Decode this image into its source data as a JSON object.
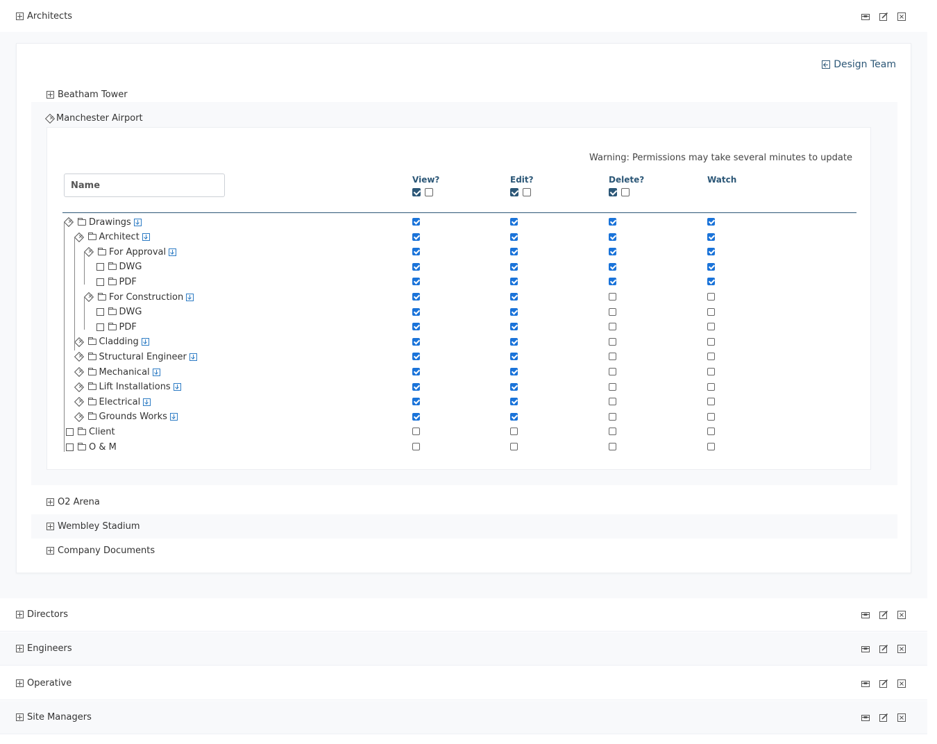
{
  "groups": [
    {
      "label": "Architects",
      "expanded": true
    },
    {
      "label": "Directors"
    },
    {
      "label": "Engineers"
    },
    {
      "label": "Operative"
    },
    {
      "label": "Site Managers"
    }
  ],
  "design_team_link": "Design Team",
  "projects": {
    "beatham": "Beatham Tower",
    "manchester": "Manchester Airport",
    "o2": "O2 Arena",
    "wembley": "Wembley Stadium",
    "company_docs": "Company Documents"
  },
  "permissions": {
    "warning": "Warning: Permissions may take several minutes to update",
    "name_placeholder": "Name",
    "columns": {
      "view": "View?",
      "edit": "Edit?",
      "delete": "Delete?",
      "watch": "Watch"
    },
    "header_checks": {
      "view": [
        true,
        false
      ],
      "edit": [
        true,
        false
      ],
      "delete": [
        true,
        false
      ]
    },
    "rows": [
      {
        "label": "Drawings",
        "level": 0,
        "type": "expanded",
        "download": true,
        "view": true,
        "edit": true,
        "delete": true,
        "watch": true
      },
      {
        "label": "Architect",
        "level": 1,
        "type": "expanded",
        "download": true,
        "view": true,
        "edit": true,
        "delete": true,
        "watch": true
      },
      {
        "label": "For Approval",
        "level": 2,
        "type": "expanded",
        "download": true,
        "view": true,
        "edit": true,
        "delete": true,
        "watch": true
      },
      {
        "label": "DWG",
        "level": 3,
        "type": "leaf",
        "download": false,
        "view": true,
        "edit": true,
        "delete": true,
        "watch": true
      },
      {
        "label": "PDF",
        "level": 3,
        "type": "leaf",
        "download": false,
        "view": true,
        "edit": true,
        "delete": true,
        "watch": true
      },
      {
        "label": "For Construction",
        "level": 2,
        "type": "expanded",
        "download": true,
        "view": true,
        "edit": true,
        "delete": false,
        "watch": false
      },
      {
        "label": "DWG",
        "level": 3,
        "type": "leaf",
        "download": false,
        "view": true,
        "edit": true,
        "delete": false,
        "watch": false
      },
      {
        "label": "PDF",
        "level": 3,
        "type": "leaf",
        "download": false,
        "view": true,
        "edit": true,
        "delete": false,
        "watch": false
      },
      {
        "label": "Cladding",
        "level": 1,
        "type": "expanded",
        "download": true,
        "view": true,
        "edit": true,
        "delete": false,
        "watch": false
      },
      {
        "label": "Structural Engineer",
        "level": 1,
        "type": "expanded",
        "download": true,
        "view": true,
        "edit": true,
        "delete": false,
        "watch": false
      },
      {
        "label": "Mechanical",
        "level": 1,
        "type": "expanded",
        "download": true,
        "view": true,
        "edit": true,
        "delete": false,
        "watch": false
      },
      {
        "label": "Lift Installations",
        "level": 1,
        "type": "expanded",
        "download": true,
        "view": true,
        "edit": true,
        "delete": false,
        "watch": false
      },
      {
        "label": "Electrical",
        "level": 1,
        "type": "expanded",
        "download": true,
        "view": true,
        "edit": true,
        "delete": false,
        "watch": false
      },
      {
        "label": "Grounds Works",
        "level": 1,
        "type": "expanded",
        "download": true,
        "view": true,
        "edit": true,
        "delete": false,
        "watch": false
      },
      {
        "label": "Client",
        "level": 0,
        "type": "leaf",
        "download": false,
        "view": false,
        "edit": false,
        "delete": false,
        "watch": false
      },
      {
        "label": "O & M",
        "level": 0,
        "type": "leaf",
        "download": false,
        "view": false,
        "edit": false,
        "delete": false,
        "watch": false
      }
    ]
  },
  "icons": {
    "expand": "plus-square-icon",
    "collapse": "diamond-x-icon",
    "folder": "folder-icon",
    "download": "download-icon",
    "archive": "archive-icon",
    "edit": "edit-icon",
    "delete": "close-box-icon",
    "back": "back-arrow-icon"
  },
  "colors": {
    "accent": "#2c5777",
    "checkbox": "#1a73d9"
  }
}
